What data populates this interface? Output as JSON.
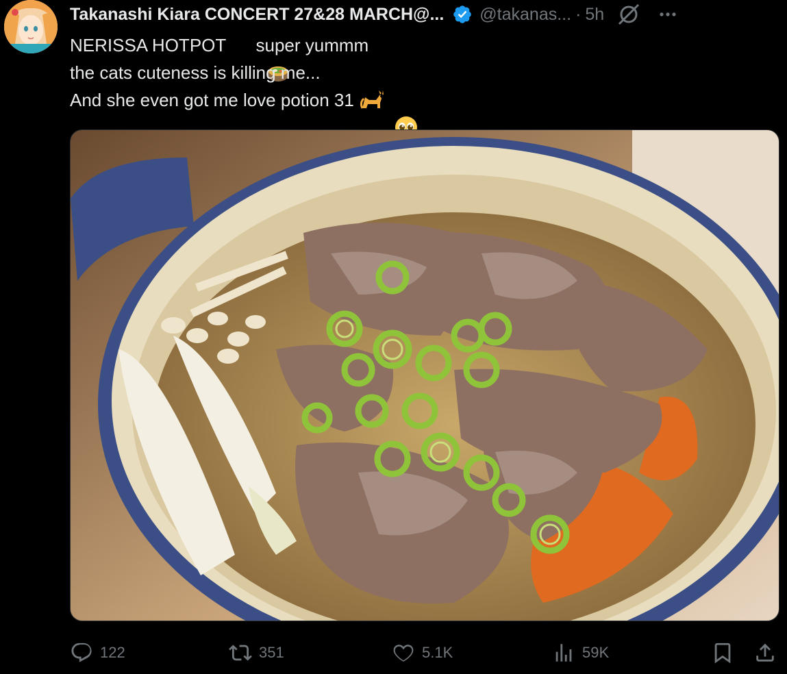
{
  "author": {
    "display_name": "Takanashi Kiara CONCERT 27&28 MARCH@...",
    "handle": "@takanas...",
    "separator": "·",
    "time": "5h",
    "verified": true
  },
  "tweet": {
    "lines": [
      {
        "before": "NERISSA HOTPOT",
        "emoji": "hotpot-emoji",
        "after": " super yummm"
      },
      {
        "before": "the cats cuteness is killing me...",
        "emoji": "cat-emoji",
        "after": ""
      },
      {
        "before": "And she even got me love potion 31",
        "emoji": "pleading-face-emoji",
        "after": ""
      }
    ]
  },
  "media": {
    "alt": "hotpot photo"
  },
  "actions": {
    "reply_count": "122",
    "repost_count": "351",
    "like_count": "5.1K",
    "views_count": "59K"
  },
  "colors": {
    "background": "#000000",
    "text_primary": "#e7e9ea",
    "text_secondary": "#71767b",
    "verified_blue": "#1d9bf0"
  },
  "icons": [
    "verified-badge-icon",
    "grok-icon",
    "more-icon",
    "reply-icon",
    "repost-icon",
    "like-icon",
    "views-icon",
    "bookmark-icon",
    "share-icon"
  ]
}
